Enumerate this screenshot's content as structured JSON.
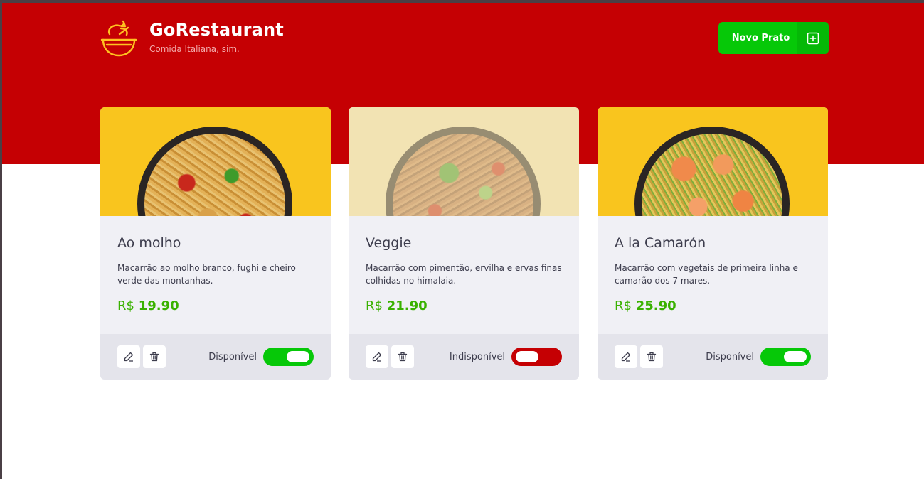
{
  "header": {
    "title": "GoRestaurant",
    "subtitle": "Comida Italiana, sim.",
    "logo_icon": "bowl-icon",
    "new_button_label": "Novo Prato",
    "new_button_icon": "plus-square-icon"
  },
  "colors": {
    "header_red": "#c50003",
    "accent_green": "#06c808",
    "price_green": "#39b100",
    "card_yellow": "#f9c51e"
  },
  "dishes": [
    {
      "name": "Ao molho",
      "description": "Macarrão ao molho branco, fughi e cheiro verde das montanhas.",
      "currency": "R$",
      "price": "19.90",
      "availability_label": "Disponível",
      "available": true
    },
    {
      "name": "Veggie",
      "description": "Macarrão com pimentão, ervilha e ervas finas colhidas no himalaia.",
      "currency": "R$",
      "price": "21.90",
      "availability_label": "Indisponível",
      "available": false
    },
    {
      "name": "A la Camarón",
      "description": "Macarrão com vegetais de primeira linha e camarão dos 7 mares.",
      "currency": "R$",
      "price": "25.90",
      "availability_label": "Disponível",
      "available": true
    }
  ]
}
